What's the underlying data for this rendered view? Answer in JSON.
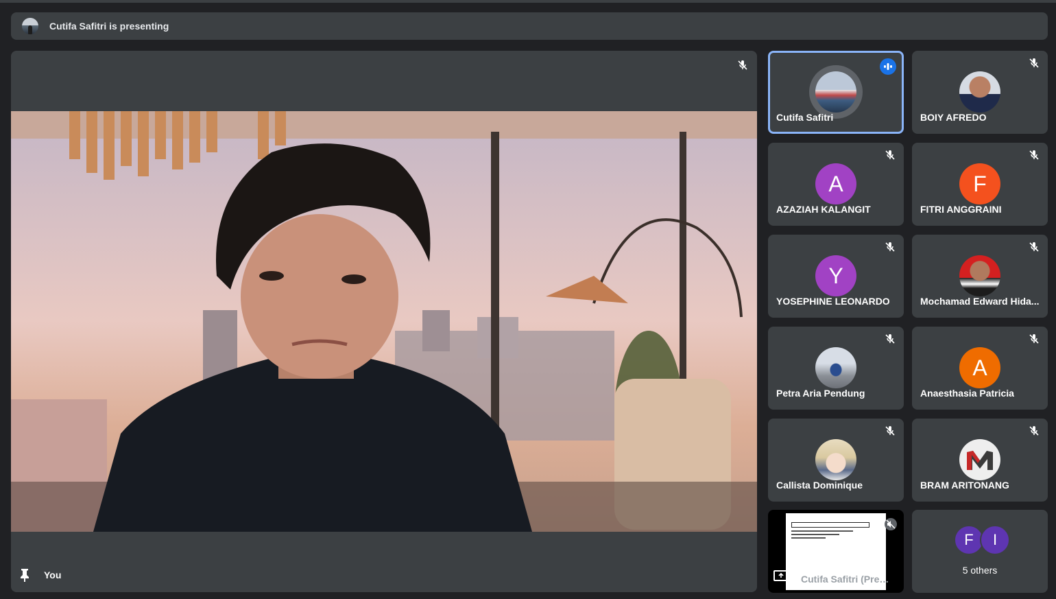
{
  "banner": {
    "text": "Cutifa Safitri is presenting"
  },
  "main": {
    "label": "You"
  },
  "participants": [
    {
      "name": "Cutifa Safitri",
      "avatar_type": "photo",
      "speaking": true
    },
    {
      "name": "BOIY AFREDO",
      "avatar_type": "photo"
    },
    {
      "name": "AZAZIAH KALANGIT",
      "initial": "A",
      "color": "#a142c4"
    },
    {
      "name": "FITRI ANGGRAINI",
      "initial": "F",
      "color": "#f4511e"
    },
    {
      "name": "YOSEPHINE LEONARDO",
      "initial": "Y",
      "color": "#a142c4"
    },
    {
      "name": "Mochamad Edward Hida...",
      "avatar_type": "photo"
    },
    {
      "name": "Petra Aria Pendung",
      "avatar_type": "photo"
    },
    {
      "name": "Anaesthasia Patricia",
      "initial": "A",
      "color": "#ef6c00"
    },
    {
      "name": "Callista Dominique",
      "avatar_type": "photo"
    },
    {
      "name": "BRAM ARITONANG",
      "avatar_type": "logo"
    }
  ],
  "presentation_tile": {
    "label": "Cutifa Safitri (Pres..."
  },
  "others": {
    "initials": [
      "F",
      "I"
    ],
    "label": "5 others",
    "colors": [
      "#5e35b1",
      "#5e35b1"
    ]
  }
}
